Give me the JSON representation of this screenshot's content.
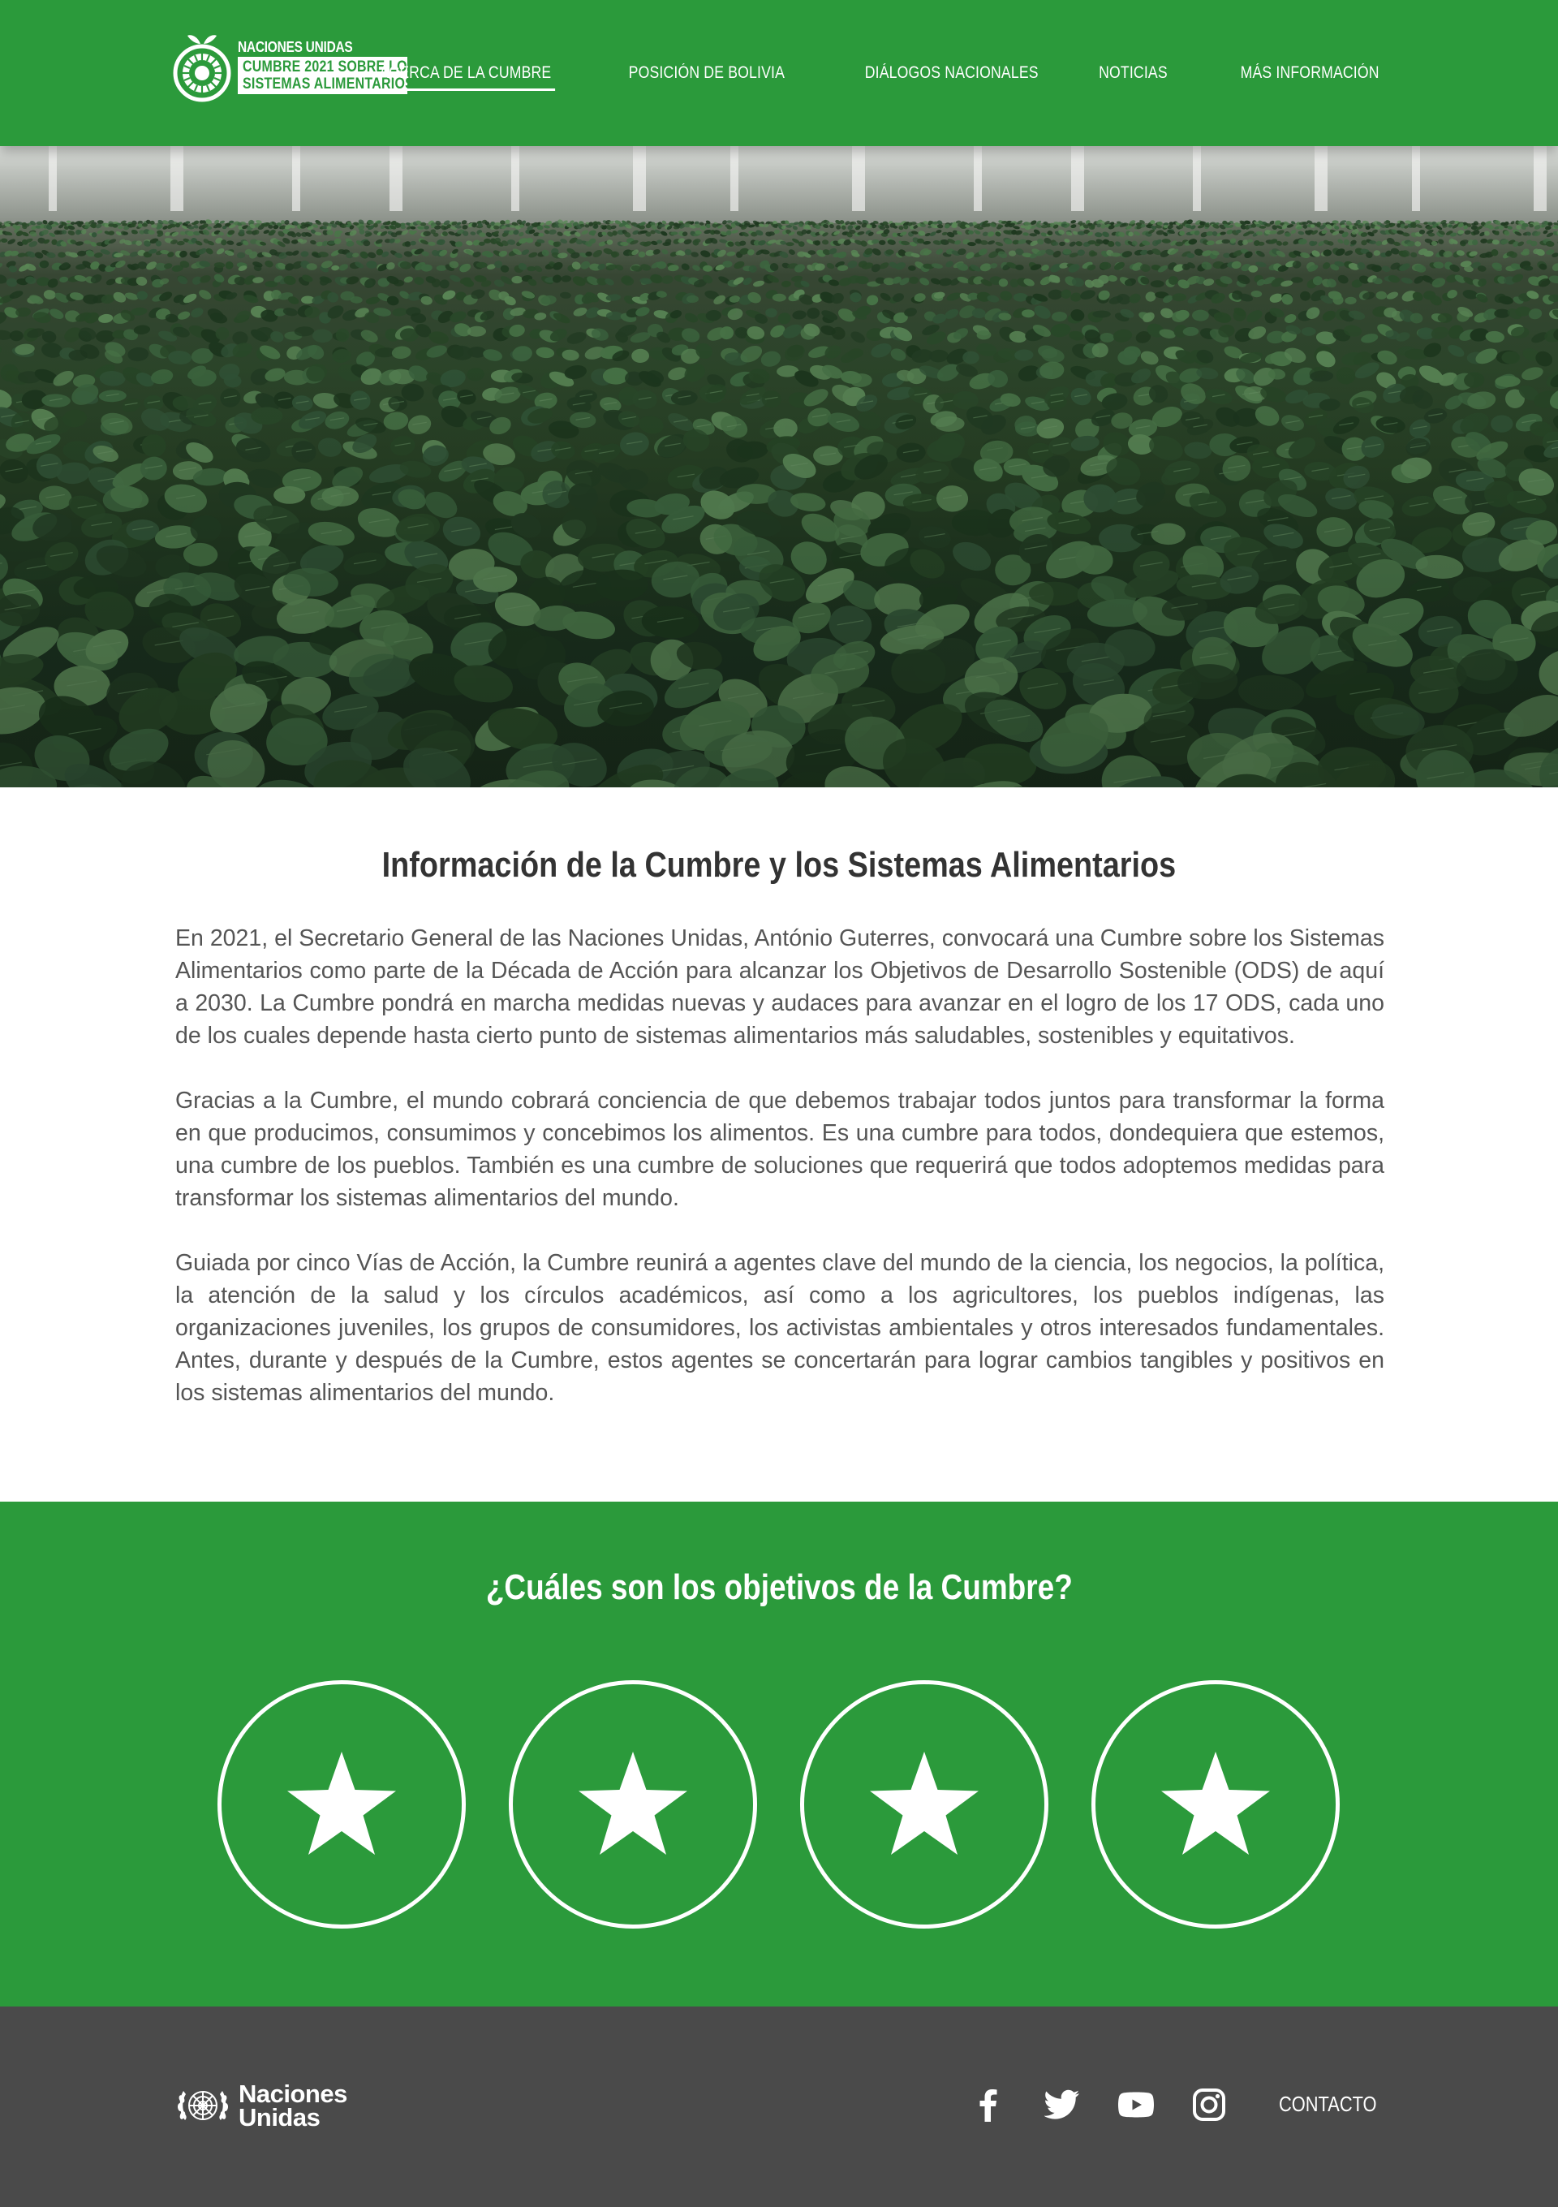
{
  "header": {
    "logo": {
      "line1": "NACIONES UNIDAS",
      "line2": "CUMBRE 2021 SOBRE LOS",
      "line3": "SISTEMAS ALIMENTARIOS"
    },
    "nav": [
      {
        "label": "ACERCA DE LA CUMBRE",
        "active": true
      },
      {
        "label": "POSICIÓN DE BOLIVIA",
        "active": false
      },
      {
        "label": "DIÁLOGOS NACIONALES",
        "active": false
      },
      {
        "label": "NOTICIAS",
        "active": false
      },
      {
        "label": "MÁS INFORMACIÓN",
        "active": false
      }
    ]
  },
  "info": {
    "title": "Información de la Cumbre y los Sistemas Alimentarios",
    "paragraphs": [
      "En 2021, el Secretario General de las Naciones Unidas, António Guterres, convocará una Cumbre sobre los Sistemas Alimentarios como parte de la Década de Acción para alcanzar los Objetivos de Desarrollo Sostenible (ODS) de aquí a 2030. La Cumbre pondrá en marcha medidas nuevas y audaces para avanzar en el logro de los 17 ODS, cada uno de los cuales depende hasta cierto punto de sistemas alimentarios más saludables, sostenibles y equitativos.",
      "Gracias a la Cumbre, el mundo cobrará conciencia de que debemos trabajar todos juntos para transformar la forma en que producimos, consumimos y concebimos los alimentos. Es una cumbre para todos, dondequiera que estemos, una cumbre de los pueblos. También es una cumbre de soluciones que requerirá que todos adoptemos medidas para transformar los sistemas alimentarios del mundo.",
      "Guiada por cinco Vías de Acción, la Cumbre reunirá a agentes clave del mundo de la ciencia, los negocios, la política, la atención de la salud y los círculos académicos, así como a los agricultores, los pueblos indígenas, las organizaciones juveniles, los grupos de consumidores, los activistas ambientales y otros interesados fundamentales. Antes, durante y después de la Cumbre, estos agentes se concertarán para lograr cambios tangibles y positivos en los sistemas alimentarios del mundo."
    ]
  },
  "objectives": {
    "title": "¿Cuáles son los objetivos de la Cumbre?",
    "items": [
      {
        "icon": "star-icon"
      },
      {
        "icon": "star-icon"
      },
      {
        "icon": "star-icon"
      },
      {
        "icon": "star-icon"
      }
    ]
  },
  "footer": {
    "un_logo": {
      "line1": "Naciones",
      "line2": "Unidas"
    },
    "socials": [
      "facebook-icon",
      "twitter-icon",
      "youtube-icon",
      "instagram-icon"
    ],
    "contact": "CONTACTO"
  },
  "colors": {
    "brand_green": "#2b9a3b",
    "footer_gray": "#4a4a4a",
    "text_gray": "#555555"
  }
}
